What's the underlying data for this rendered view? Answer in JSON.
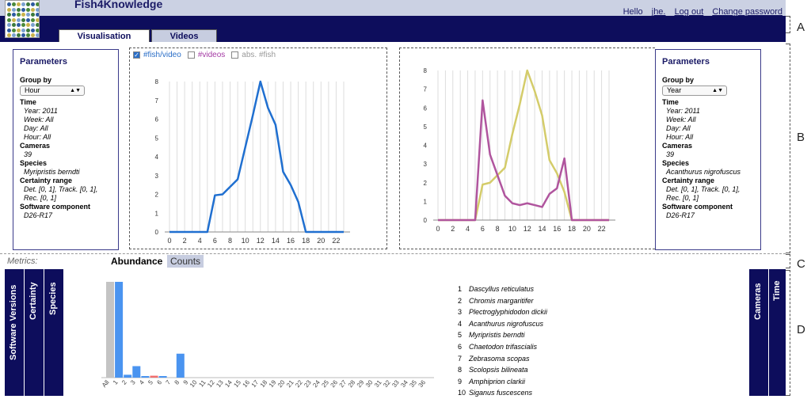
{
  "app": {
    "title": "Fish4Knowledge"
  },
  "user_links": {
    "hello": "Hello",
    "user": "jhe.",
    "logout": "Log out",
    "change_password": "Change password"
  },
  "tabs": {
    "visualisation": "Visualisation",
    "videos": "Videos"
  },
  "markers": {
    "a": "A",
    "b": "B",
    "c": "C",
    "d": "D"
  },
  "params_left": {
    "title": "Parameters",
    "group_by_label": "Group by",
    "group_by_value": "Hour",
    "time_label": "Time",
    "year": "Year: 2011",
    "week": "Week: All",
    "day": "Day: All",
    "hour": "Hour: All",
    "cameras_label": "Cameras",
    "cameras_value": "39",
    "species_label": "Species",
    "species_value": "Myripristis berndti",
    "certainty_label": "Certainty range",
    "certainty_value1": "Det. [0, 1], Track. [0, 1],",
    "certainty_value2": "Rec. [0, 1]",
    "software_label": "Software component",
    "software_value": "D26-R17"
  },
  "params_right": {
    "title": "Parameters",
    "group_by_label": "Group by",
    "group_by_value": "Year",
    "time_label": "Time",
    "year": "Year: 2011",
    "week": "Week: All",
    "day": "Day: All",
    "hour": "Hour: All",
    "cameras_label": "Cameras",
    "cameras_value": "39",
    "species_label": "Species",
    "species_value": "Acanthurus nigrofuscus",
    "certainty_label": "Certainty range",
    "certainty_value1": "Det. [0, 1], Track. [0, 1],",
    "certainty_value2": "Rec. [0, 1]",
    "software_label": "Software component",
    "software_value": "D26-R17"
  },
  "toggles": {
    "fish_per_video": "#fish/video",
    "videos": "#videos",
    "abs_fish": "abs. #fish"
  },
  "metrics": {
    "label": "Metrics:",
    "abundance": "Abundance",
    "counts": "Counts"
  },
  "side_bars": {
    "software_versions": "Software Versions",
    "certainty": "Certainty",
    "species": "Species",
    "cameras": "Cameras",
    "time": "Time"
  },
  "species_list": [
    {
      "n": "1",
      "name": "Dascyllus reticulatus"
    },
    {
      "n": "2",
      "name": "Chromis margaritifer"
    },
    {
      "n": "3",
      "name": "Plectroglyphidodon dickii"
    },
    {
      "n": "4",
      "name": "Acanthurus nigrofuscus"
    },
    {
      "n": "5",
      "name": "Myripristis berndti"
    },
    {
      "n": "6",
      "name": "Chaetodon trifascialis"
    },
    {
      "n": "7",
      "name": "Zebrasoma scopas"
    },
    {
      "n": "8",
      "name": "Scolopsis bilineata"
    },
    {
      "n": "9",
      "name": "Amphiprion clarkii"
    },
    {
      "n": "10",
      "name": "Siganus fuscescens"
    }
  ],
  "colors": {
    "navy": "#0d0d5c",
    "blue_series": "#1f6fd0",
    "yellow_series": "#d4cc6a",
    "purple_series": "#b0559e",
    "bar_blue": "#4a94f0",
    "bar_gray": "#c4c4c4",
    "bar_red": "#f06f6f"
  },
  "chart_data": [
    {
      "type": "line",
      "x": [
        0,
        1,
        2,
        3,
        4,
        5,
        6,
        7,
        8,
        9,
        10,
        11,
        12,
        13,
        14,
        15,
        16,
        17,
        18,
        19,
        20,
        21,
        22,
        23
      ],
      "xticks": [
        "0",
        "2",
        "4",
        "6",
        "8",
        "10",
        "12",
        "14",
        "16",
        "18",
        "20",
        "22"
      ],
      "yticks": [
        "0",
        "1",
        "2",
        "3",
        "4",
        "5",
        "6",
        "7",
        "8"
      ],
      "ylim": [
        0,
        8
      ],
      "series": [
        {
          "name": "#fish/video",
          "color": "#1f6fd0",
          "values": [
            0,
            0,
            0,
            0,
            0,
            0,
            1.95,
            2,
            2.4,
            2.8,
            4.5,
            6.2,
            8,
            6.6,
            5.7,
            3.2,
            2.5,
            1.6,
            0,
            0,
            0,
            0,
            0,
            0
          ]
        }
      ]
    },
    {
      "type": "line",
      "x": [
        0,
        1,
        2,
        3,
        4,
        5,
        6,
        7,
        8,
        9,
        10,
        11,
        12,
        13,
        14,
        15,
        16,
        17,
        18,
        19,
        20,
        21,
        22,
        23
      ],
      "xticks": [
        "0",
        "2",
        "4",
        "6",
        "8",
        "10",
        "12",
        "14",
        "16",
        "18",
        "20",
        "22"
      ],
      "yticks": [
        "0",
        "1",
        "2",
        "3",
        "4",
        "5",
        "6",
        "7",
        "8"
      ],
      "ylim": [
        0,
        8
      ],
      "series": [
        {
          "color": "#d4cc6a",
          "values": [
            0,
            0,
            0,
            0,
            0,
            0,
            1.9,
            2,
            2.4,
            2.8,
            4.6,
            6.2,
            8,
            6.9,
            5.6,
            3.2,
            2.5,
            1.5,
            0,
            0,
            0,
            0,
            0,
            0
          ]
        },
        {
          "color": "#b0559e",
          "values": [
            0,
            0,
            0,
            0,
            0,
            0,
            6.4,
            3.5,
            2.4,
            1.3,
            0.9,
            0.8,
            0.9,
            0.8,
            0.7,
            1.4,
            1.7,
            3.3,
            0,
            0,
            0,
            0,
            0,
            0
          ]
        }
      ]
    },
    {
      "type": "bar",
      "categories": [
        "All",
        "1",
        "2",
        "3",
        "4",
        "5",
        "6",
        "7",
        "8",
        "9",
        "10",
        "11",
        "12",
        "13",
        "14",
        "15",
        "16",
        "17",
        "18",
        "19",
        "20",
        "21",
        "22",
        "23",
        "24",
        "25",
        "26",
        "27",
        "28",
        "29",
        "30",
        "31",
        "32",
        "33",
        "34",
        "35",
        "36"
      ],
      "values": [
        1,
        1,
        0.03,
        0.12,
        0.005,
        0.02,
        0.005,
        0,
        0.25,
        0,
        0,
        0,
        0,
        0,
        0,
        0,
        0,
        0,
        0,
        0,
        0,
        0,
        0,
        0,
        0,
        0,
        0,
        0,
        0,
        0,
        0,
        0,
        0,
        0,
        0,
        0,
        0
      ],
      "highlight_index": 5
    }
  ]
}
